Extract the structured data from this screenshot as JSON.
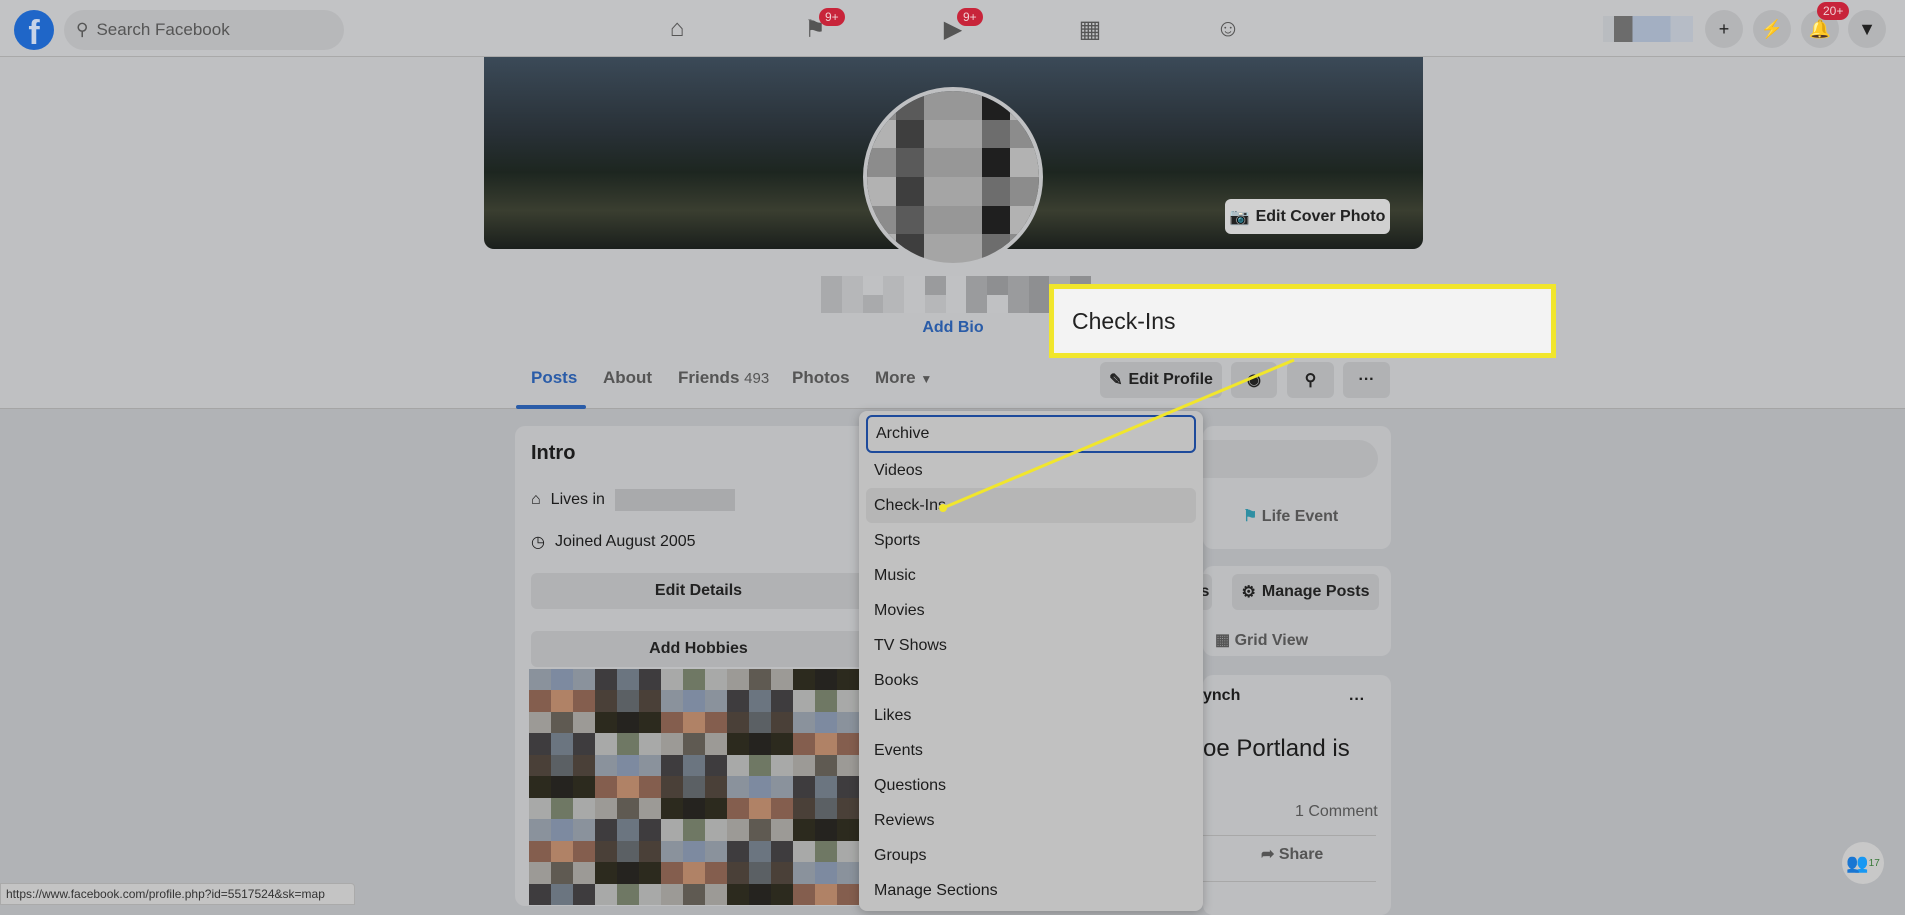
{
  "topbar": {
    "search_placeholder": "Search Facebook",
    "nav": [
      {
        "icon": "home-icon",
        "badge": ""
      },
      {
        "icon": "flag-icon",
        "badge": "9+"
      },
      {
        "icon": "watch-icon",
        "badge": "9+"
      },
      {
        "icon": "marketplace-icon",
        "badge": ""
      },
      {
        "icon": "groups-icon",
        "badge": ""
      }
    ],
    "notifications_badge": "20+"
  },
  "profile": {
    "edit_cover_label": "Edit Cover Photo",
    "add_bio": "Add Bio"
  },
  "tabs": {
    "posts": "Posts",
    "about": "About",
    "friends": "Friends",
    "friends_count": "493",
    "photos": "Photos",
    "more": "More"
  },
  "actions": {
    "edit_profile": "Edit Profile"
  },
  "callout": {
    "text": "Check-Ins",
    "color": "#f1e62c"
  },
  "intro": {
    "title": "Intro",
    "lives_in": "Lives in",
    "joined": "Joined August 2005",
    "edit_details": "Edit Details",
    "add_hobbies": "Add Hobbies"
  },
  "dropdown": {
    "items": [
      "Archive",
      "Videos",
      "Check-Ins",
      "Sports",
      "Music",
      "Movies",
      "TV Shows",
      "Books",
      "Likes",
      "Events",
      "Questions",
      "Reviews",
      "Groups",
      "Manage Sections"
    ]
  },
  "right": {
    "life_event": "Life Event",
    "filters_partial": "s",
    "manage_posts": "Manage Posts",
    "grid_view": "Grid View",
    "post_author_partial": "ynch",
    "post_text_partial": "oe Portland is",
    "comments": "1 Comment",
    "share": "Share"
  },
  "status_url": "https://www.facebook.com/profile.php?id=5517524&sk=map",
  "contacts_badge": "17"
}
